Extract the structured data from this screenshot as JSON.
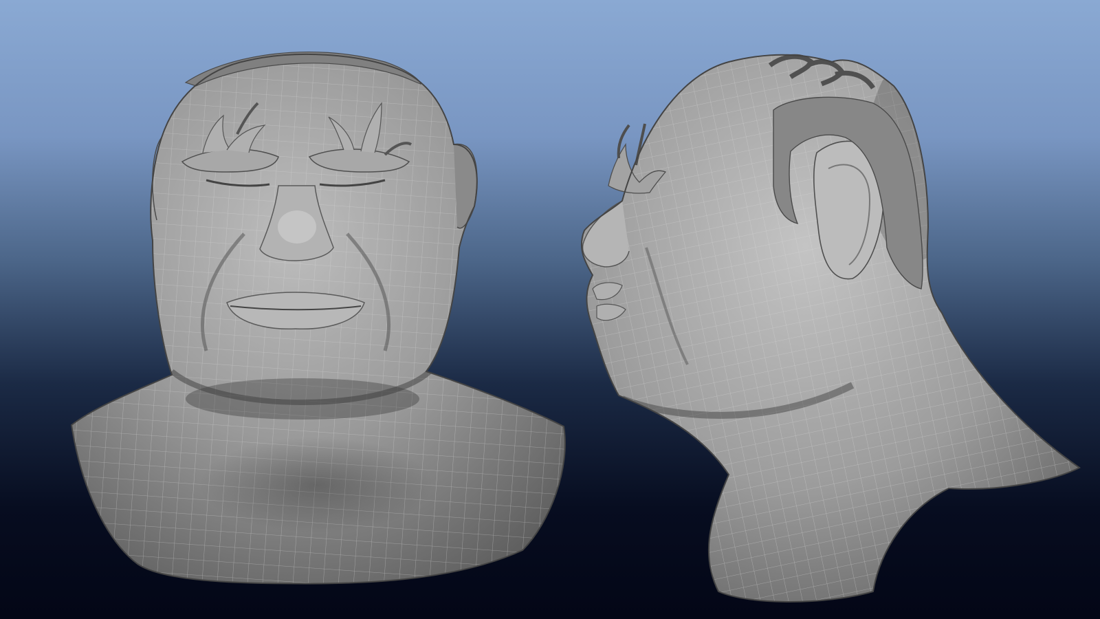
{
  "viewport": {
    "background": {
      "top": "#8aa9d3",
      "mid": "#5f7ca4",
      "lower": "#1a2741",
      "bottom": "#040818"
    },
    "mesh_color": "#8c8c8c",
    "wire_color": "#d8d8d8"
  },
  "models": [
    {
      "view": "front"
    },
    {
      "view": "side"
    }
  ]
}
